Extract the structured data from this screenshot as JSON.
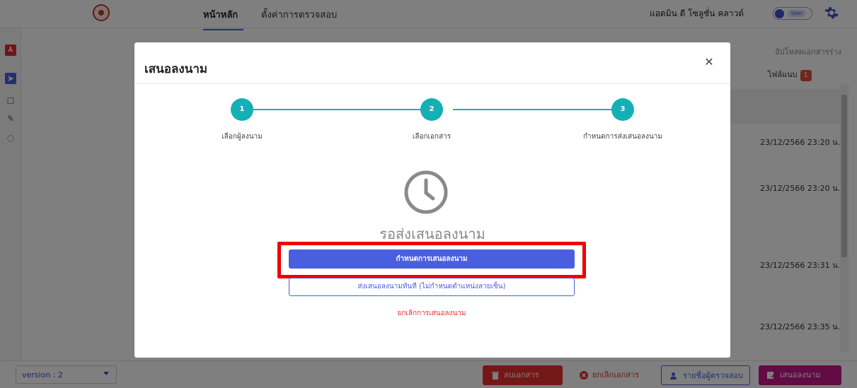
{
  "topbar": {
    "nav_tabs": [
      {
        "label": "หน้าหลัก"
      },
      {
        "label": "ตั้งค่าการตรวจสอบ"
      }
    ],
    "user_name": "แอดมิน ดี โซลูชั่น คลาวด์",
    "role_toggle_label": "User"
  },
  "right_panel": {
    "upload_draft_label": "อัปโหลดเอกสารร่าง",
    "attachment_label": "ไฟล์แนบ",
    "attachment_count": "1",
    "dates": [
      "23/12/2566 23:20 น.",
      "23/12/2566 23:20 น.",
      "23/12/2566 23:31 น.",
      "23/12/2566 23:35 น."
    ]
  },
  "bottombar": {
    "version_label": "version : 2",
    "delete_doc_label": "ลบเอกสาร",
    "cancel_doc_label": "ยกเลิกเอกสาร",
    "reviewers_label": "รายชื่อผู้ตรวจสอบ",
    "propose_sign_label": "เสนอลงนาม"
  },
  "modal": {
    "title": "เสนอลงนาม",
    "steps": [
      {
        "number": "1",
        "label": "เลือกผู้ลงนาม"
      },
      {
        "number": "2",
        "label": "เลือกเอกสาร"
      },
      {
        "number": "3",
        "label": "กำหนดการส่งเสนอลงนาม"
      }
    ],
    "status_text": "รอส่งเสนอลงนาม",
    "set_signing_label": "กำหนดการเสนอลงนาม",
    "send_now_label": "ส่งเสนอลงนามทันที (ไม่กำหนดตำแหน่งลายเซ็น)",
    "cancel_label": "ยกเลิกการเสนอลงนาม"
  },
  "colors": {
    "primary": "#4a5fe0",
    "step_teal": "#14b0b6",
    "danger": "#e8302e",
    "propose": "#c6178b",
    "highlight": "#ee0000"
  }
}
